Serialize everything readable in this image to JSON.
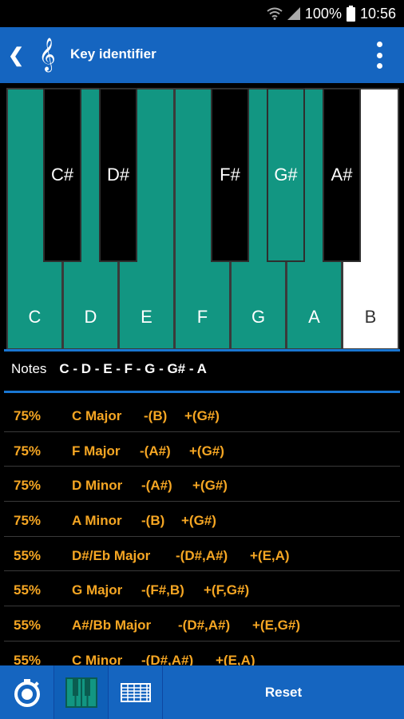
{
  "status": {
    "battery": "100%",
    "time": "10:56"
  },
  "app": {
    "title": "Key identifier"
  },
  "keyboard": {
    "white_keys": [
      {
        "label": "C",
        "active": true
      },
      {
        "label": "D",
        "active": true
      },
      {
        "label": "E",
        "active": true
      },
      {
        "label": "F",
        "active": true
      },
      {
        "label": "G",
        "active": true
      },
      {
        "label": "A",
        "active": true
      },
      {
        "label": "B",
        "active": false
      }
    ],
    "black_keys": [
      {
        "label": "C#",
        "active": false
      },
      {
        "label": "D#",
        "active": false
      },
      {
        "label": "F#",
        "active": false
      },
      {
        "label": "G#",
        "active": true
      },
      {
        "label": "A#",
        "active": false
      }
    ],
    "active_color": "#129682",
    "inactive_white_color": "#ffffff",
    "inactive_black_color": "#000000"
  },
  "notes": {
    "label": "Notes",
    "value": "C - D - E - F - G - G# - A"
  },
  "results": [
    {
      "percent": "75%",
      "key": "C Major",
      "missing": "-(B)",
      "extra": "+(G#)"
    },
    {
      "percent": "75%",
      "key": "F Major",
      "missing": "-(A#)",
      "extra": "+(G#)"
    },
    {
      "percent": "75%",
      "key": "D Minor",
      "missing": "-(A#)",
      "extra": "+(G#)"
    },
    {
      "percent": "75%",
      "key": "A Minor",
      "missing": "-(B)",
      "extra": "+(G#)"
    },
    {
      "percent": "55%",
      "key": "D#/Eb Major",
      "missing": "-(D#,A#)",
      "extra": "+(E,A)"
    },
    {
      "percent": "55%",
      "key": "G Major",
      "missing": "-(F#,B)",
      "extra": "+(F,G#)"
    },
    {
      "percent": "55%",
      "key": "A#/Bb Major",
      "missing": "-(D#,A#)",
      "extra": "+(E,G#)"
    },
    {
      "percent": "55%",
      "key": "C Minor",
      "missing": "-(D#,A#)",
      "extra": "+(E,A)"
    }
  ],
  "bottom_bar": {
    "tabs": [
      {
        "icon": "tuner-dial-icon",
        "active": false
      },
      {
        "icon": "piano-keys-icon",
        "active": true
      },
      {
        "icon": "guitar-fretboard-icon",
        "active": false
      }
    ],
    "reset_label": "Reset"
  },
  "colors": {
    "accent": "#1565c0",
    "result_text": "#f5a623"
  }
}
